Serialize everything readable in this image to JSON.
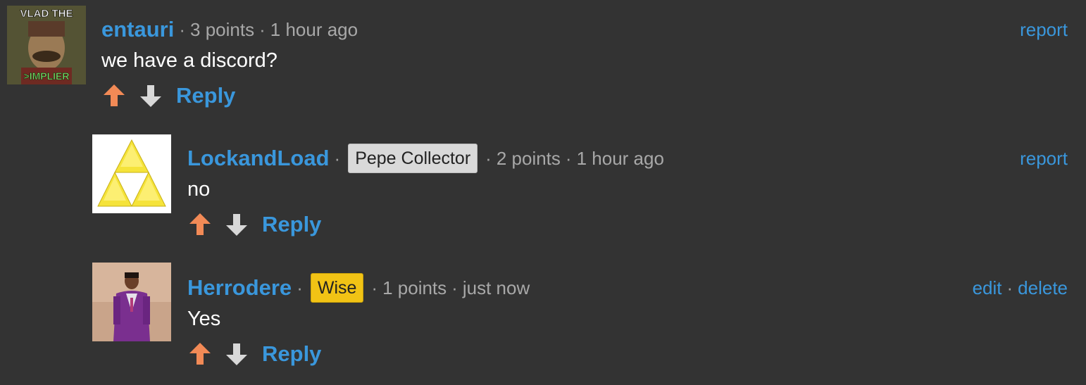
{
  "colors": {
    "background": "#333333",
    "link": "#3a97dc",
    "upvote": "#f28a56",
    "downvote": "#d8d8d8",
    "meta": "#a8a8a8",
    "flair_pepe": "#d9d9d9",
    "flair_wise": "#f1c315"
  },
  "comments": [
    {
      "username": "entauri",
      "separator": "·",
      "points": "3 points",
      "time": "1 hour ago",
      "body": "we have a discord?",
      "actions": [
        "report"
      ],
      "reply_label": "Reply",
      "avatar": {
        "top_text": "VLAD THE",
        "bottom_text": ">IMPLIER"
      }
    },
    {
      "username": "LockandLoad",
      "separator": "·",
      "flair": "Pepe Collector",
      "points": "2 points",
      "time": "1 hour ago",
      "body": "no",
      "actions": [
        "report"
      ],
      "reply_label": "Reply"
    },
    {
      "username": "Herrodere",
      "separator": "·",
      "flair": "Wise",
      "points": "1 points",
      "time": "just now",
      "body": "Yes",
      "actions": [
        "edit",
        "delete"
      ],
      "reply_label": "Reply"
    }
  ]
}
